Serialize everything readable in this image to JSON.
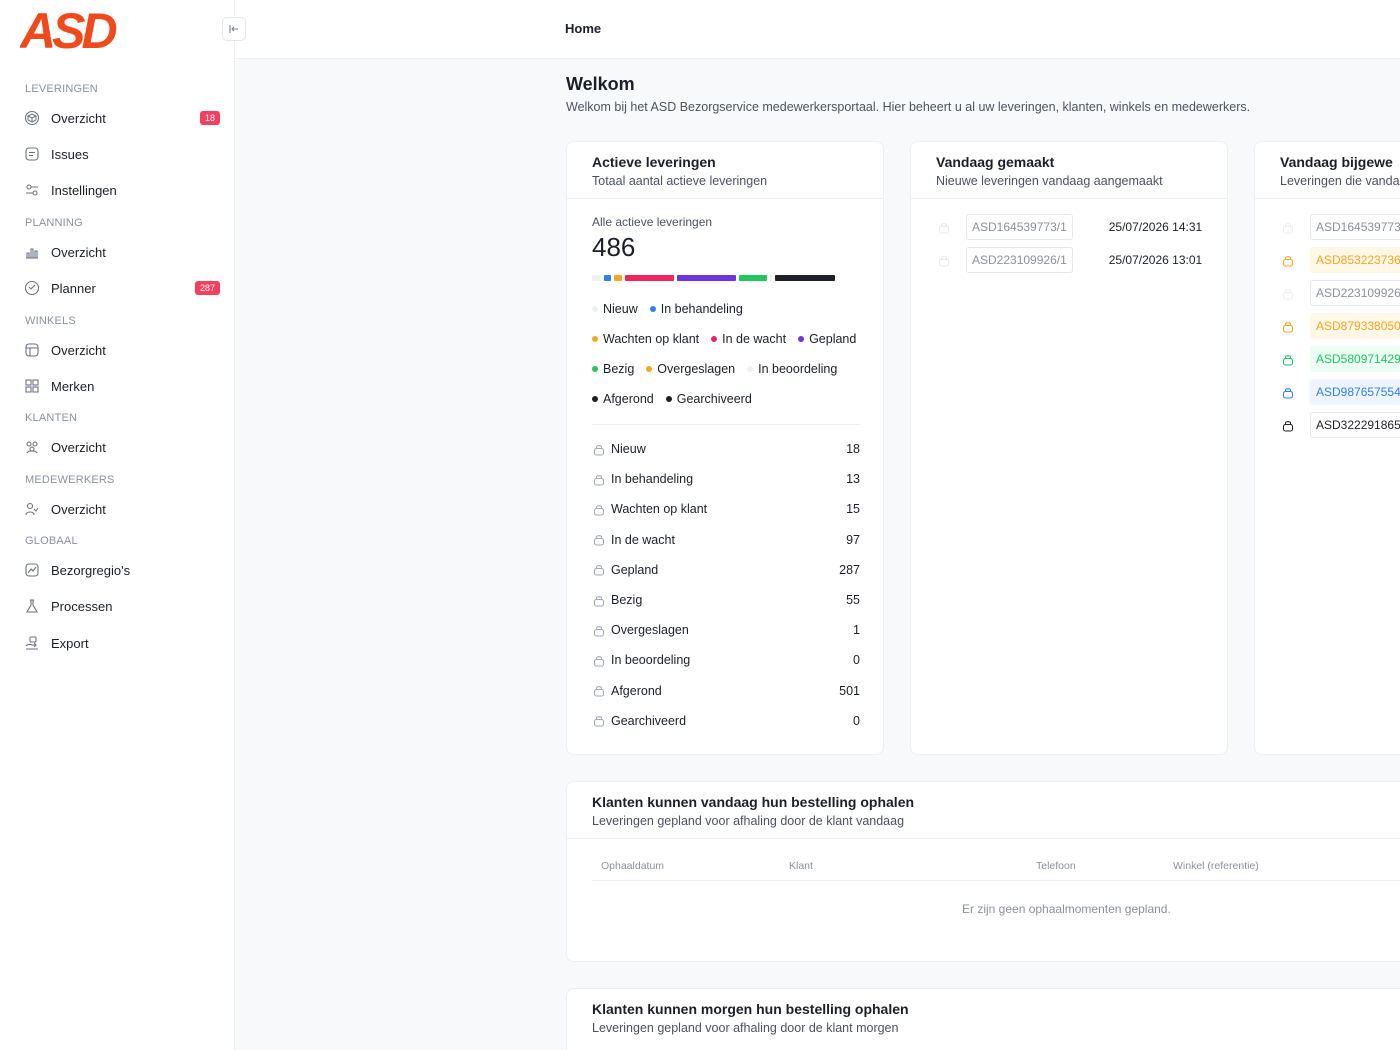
{
  "brand": {
    "logo_text": "ASD",
    "accent": "#f04a1c"
  },
  "sidebar": {
    "sections": [
      {
        "label": "LEVERINGEN",
        "items": [
          {
            "label": "Overzicht",
            "icon": "box-icon",
            "badge": "18"
          },
          {
            "label": "Issues",
            "icon": "issue-icon"
          },
          {
            "label": "Instellingen",
            "icon": "settings-icon"
          }
        ]
      },
      {
        "label": "PLANNING",
        "items": [
          {
            "label": "Overzicht",
            "icon": "chart-icon"
          },
          {
            "label": "Planner",
            "icon": "planner-icon",
            "badge": "287"
          }
        ]
      },
      {
        "label": "WINKELS",
        "items": [
          {
            "label": "Overzicht",
            "icon": "store-icon"
          },
          {
            "label": "Merken",
            "icon": "grid-icon"
          }
        ]
      },
      {
        "label": "KLANTEN",
        "items": [
          {
            "label": "Overzicht",
            "icon": "users-icon"
          }
        ]
      },
      {
        "label": "MEDEWERKERS",
        "items": [
          {
            "label": "Overzicht",
            "icon": "team-icon"
          }
        ]
      },
      {
        "label": "GLOBAAL",
        "items": [
          {
            "label": "Bezorgregio's",
            "icon": "map-icon"
          },
          {
            "label": "Processen",
            "icon": "flask-icon"
          },
          {
            "label": "Export",
            "icon": "export-icon"
          }
        ]
      }
    ]
  },
  "header": {
    "breadcrumb": "Home"
  },
  "page": {
    "title": "Welkom",
    "subtitle": "Welkom bij het ASD Bezorgservice medewerkersportaal. Hier beheert u al uw leveringen, klanten, winkels en medewerkers."
  },
  "active": {
    "title": "Actieve leveringen",
    "subtitle": "Totaal aantal actieve leveringen",
    "stat_label": "Alle actieve leveringen",
    "stat_value": "486",
    "progress": [
      {
        "color": "#eef0f3",
        "share": 0.037
      },
      {
        "color": "#2f80ed",
        "share": 0.027
      },
      {
        "color": "#f5a623",
        "share": 0.031
      },
      {
        "color": "#f0245f",
        "share": 0.2
      },
      {
        "color": "#6d35e0",
        "share": 0.24
      },
      {
        "color": "#22c55e",
        "share": 0.113
      },
      {
        "color": "#eef0f3",
        "share": 0.01
      },
      {
        "color": "#1f2028",
        "share": 0.242
      }
    ],
    "legend": [
      {
        "label": "Nieuw",
        "color": "#eef0f3"
      },
      {
        "label": "In behandeling",
        "color": "#2f80ed"
      },
      {
        "label": "Wachten op klant",
        "color": "#f5a623"
      },
      {
        "label": "In de wacht",
        "color": "#f0245f"
      },
      {
        "label": "Gepland",
        "color": "#6d35e0"
      },
      {
        "label": "Bezig",
        "color": "#22c55e"
      },
      {
        "label": "Overgeslagen",
        "color": "#f5a623"
      },
      {
        "label": "In beoordeling",
        "color": "#eef0f3"
      },
      {
        "label": "Afgerond",
        "color": "#1f2028"
      },
      {
        "label": "Gearchiveerd",
        "color": "#1f2028"
      }
    ],
    "statuses": [
      {
        "label": "Nieuw",
        "count": "18"
      },
      {
        "label": "In behandeling",
        "count": "13"
      },
      {
        "label": "Wachten op klant",
        "count": "15"
      },
      {
        "label": "In de wacht",
        "count": "97"
      },
      {
        "label": "Gepland",
        "count": "287"
      },
      {
        "label": "Bezig",
        "count": "55"
      },
      {
        "label": "Overgeslagen",
        "count": "1"
      },
      {
        "label": "In beoordeling",
        "count": "0"
      },
      {
        "label": "Afgerond",
        "count": "501"
      },
      {
        "label": "Gearchiveerd",
        "count": "0"
      }
    ]
  },
  "today_created": {
    "title": "Vandaag gemaakt",
    "subtitle": "Nieuwe leveringen vandaag aangemaakt",
    "rows": [
      {
        "code": "ASD164539773/1",
        "date": "25/07/2026 14:31"
      },
      {
        "code": "ASD223109926/1",
        "date": "25/07/2026 13:01"
      }
    ]
  },
  "today_updated": {
    "title": "Vandaag bijgewe",
    "subtitle": "Leveringen die vandaa",
    "rows": [
      {
        "code": "ASD164539773",
        "color": "#c9ccd3",
        "bg": "#ffffff",
        "text": "#8a91a0"
      },
      {
        "code": "ASD853223736",
        "color": "#f5a623",
        "bg": "#fff8e6",
        "text": "#f5a623"
      },
      {
        "code": "ASD223109926",
        "color": "#c9ccd3",
        "bg": "#ffffff",
        "text": "#8a91a0"
      },
      {
        "code": "ASD879338050",
        "color": "#f5a623",
        "bg": "#fff8e6",
        "text": "#f5a623"
      },
      {
        "code": "ASD580971429",
        "color": "#22c55e",
        "bg": "#ecfdf3",
        "text": "#22c55e"
      },
      {
        "code": "ASD987657554",
        "color": "#2f80ed",
        "bg": "#eef5ff",
        "text": "#2f80ed"
      },
      {
        "code": "ASD322291865",
        "color": "#1f2028",
        "bg": "#ffffff",
        "text": "#1f2028"
      }
    ]
  },
  "pickup_today": {
    "title": "Klanten kunnen vandaag hun bestelling ophalen",
    "subtitle": "Leveringen gepland voor afhaling door de klant vandaag",
    "columns": [
      "Ophaaldatum",
      "Klant",
      "Telefoon",
      "Winkel (referentie)"
    ],
    "empty": "Er zijn geen ophaalmomenten gepland."
  },
  "pickup_tomorrow": {
    "title": "Klanten kunnen morgen hun bestelling ophalen",
    "subtitle": "Leveringen gepland voor afhaling door de klant morgen"
  }
}
